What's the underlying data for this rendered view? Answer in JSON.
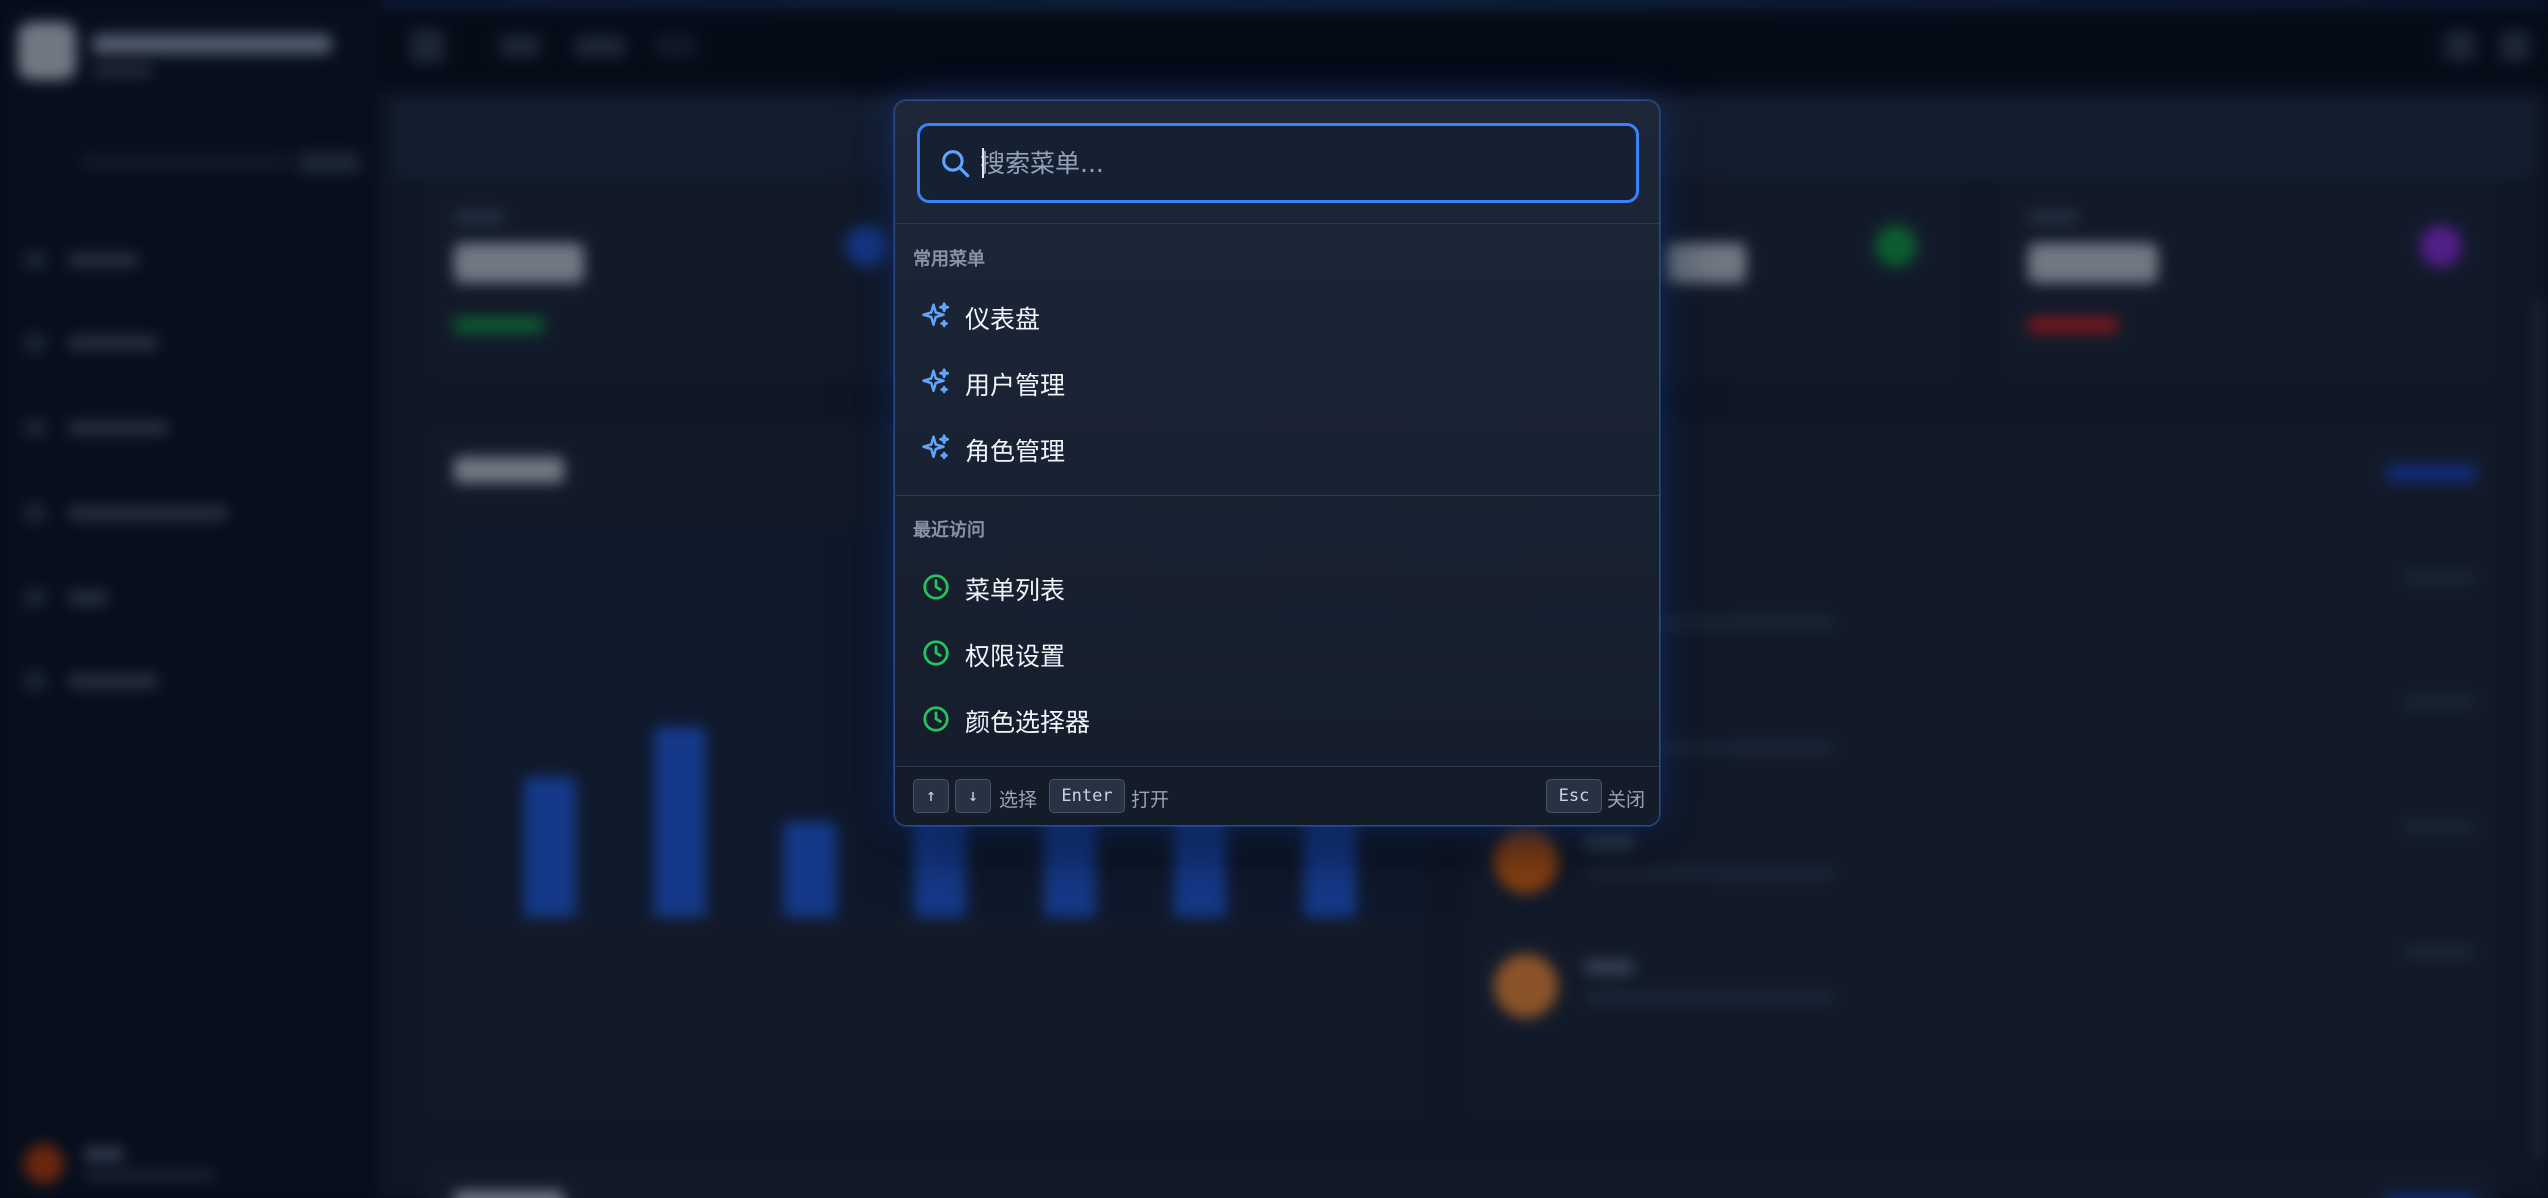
{
  "palette": {
    "search_placeholder": "搜索菜单...",
    "sections": [
      {
        "title": "常用菜单",
        "icon": "sparkles-icon",
        "icon_color": "#60a5fa",
        "items": [
          {
            "label": "仪表盘"
          },
          {
            "label": "用户管理"
          },
          {
            "label": "角色管理"
          }
        ]
      },
      {
        "title": "最近访问",
        "icon": "clock-icon",
        "icon_color": "#22c55e",
        "items": [
          {
            "label": "菜单列表"
          },
          {
            "label": "权限设置"
          },
          {
            "label": "颜色选择器"
          }
        ]
      }
    ],
    "footer": {
      "up_key": "↑",
      "down_key": "↓",
      "select_hint": "选择",
      "enter_key": "Enter",
      "open_hint": "打开",
      "esc_key": "Esc",
      "close_hint": "关闭"
    }
  },
  "colors": {
    "accent": "#3b82f6",
    "overlay_bg": "#030712"
  }
}
